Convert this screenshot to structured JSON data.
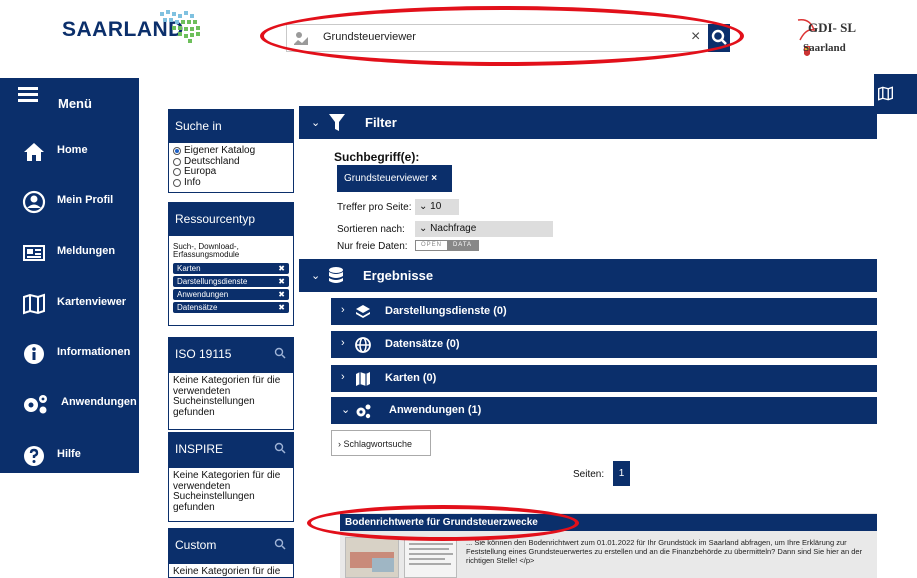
{
  "header": {
    "logo_text": "SAARLAND",
    "search_value": "Grundsteuerviewer",
    "gdi_text": "GDI- SL",
    "gdi_state": "Saarland"
  },
  "sidebar": {
    "menu_label": "Menü",
    "items": [
      {
        "label": "Home",
        "icon": "home-icon"
      },
      {
        "label": "Mein Profil",
        "icon": "profile-icon"
      },
      {
        "label": "Meldungen",
        "icon": "news-icon"
      },
      {
        "label": "Kartenviewer",
        "icon": "map-icon"
      },
      {
        "label": "Informationen",
        "icon": "info-icon"
      },
      {
        "label": "Anwendungen",
        "icon": "gears-icon"
      },
      {
        "label": "Hilfe",
        "icon": "help-icon"
      }
    ]
  },
  "facets": {
    "suche_in": {
      "title": "Suche in",
      "options": [
        "Eigener Katalog",
        "Deutschland",
        "Europa",
        "Info"
      ],
      "selected": "Eigener Katalog"
    },
    "ressourcentyp": {
      "title": "Ressourcentyp",
      "desc": "Such-, Download-, Erfassungsmodule",
      "chips": [
        "Karten",
        "Darstellungsdienste",
        "Anwendungen",
        "Datensätze"
      ]
    },
    "iso": {
      "title": "ISO 19115",
      "text": "Keine Kategorien für die verwendeten Sucheinstellungen gefunden"
    },
    "inspire": {
      "title": "INSPIRE",
      "text": "Keine Kategorien für die verwendeten Sucheinstellungen gefunden"
    },
    "custom": {
      "title": "Custom",
      "text": "Keine Kategorien für die"
    }
  },
  "filter": {
    "title": "Filter",
    "suchbegriff_label": "Suchbegriff(e):",
    "suchbegriff_chip": "Grundsteuerviewer",
    "treffer_label": "Treffer pro Seite:",
    "treffer_value": "10",
    "sortieren_label": "Sortieren nach:",
    "sortieren_value": "Nachfrage",
    "freie_label": "Nur freie Daten:",
    "open_data_left": "OPEN",
    "open_data_right": "DATA"
  },
  "results": {
    "title": "Ergebnisse",
    "groups": [
      {
        "label": "Darstellungsdienste (0)"
      },
      {
        "label": "Datensätze (0)"
      },
      {
        "label": "Karten (0)"
      },
      {
        "label": "Anwendungen (1)"
      }
    ],
    "schlagwort": "Schlagwortsuche",
    "pages_label": "Seiten:",
    "page_current": "1",
    "card_title": "Bodenrichtwerte für Grundsteuerzwecke",
    "card_desc": "... Sie können den Bodenrichtwert zum 01.01.2022 für Ihr Grundstück im Saarland abfragen, um Ihre Erklärung zur Feststellung eines Grundsteuerwertes zu erstellen und an die Finanzbehörde zu übermitteln? Dann sind Sie hier an der richtigen Stelle! </p>"
  },
  "colors": {
    "navy": "#0b2f6b",
    "highlight_red": "#e2101a"
  }
}
